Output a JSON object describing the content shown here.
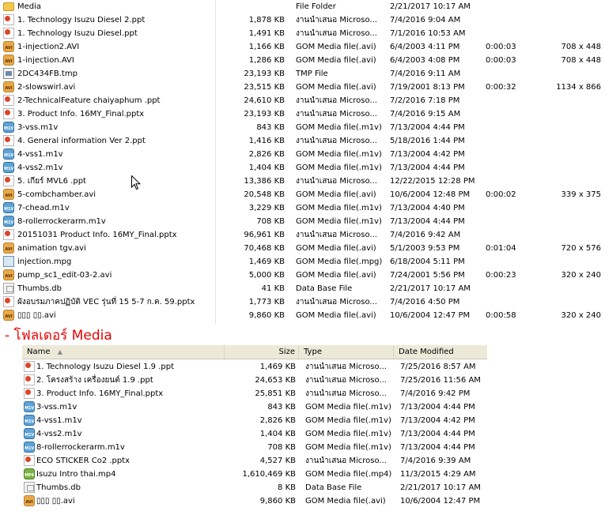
{
  "panel1": {
    "rows": [
      {
        "icon": "folder-icon",
        "name": "Media",
        "size": "",
        "type": "File Folder",
        "date": "2/21/2017 10:17 AM",
        "duration": "",
        "dimensions": ""
      },
      {
        "icon": "ppt-icon",
        "name": "1. Technology Isuzu Diesel 2.ppt",
        "size": "1,878 KB",
        "type": "งานนำเสนอ Microso...",
        "date": "7/4/2016 9:04 AM",
        "duration": "",
        "dimensions": ""
      },
      {
        "icon": "ppt-icon",
        "name": "1. Technology Isuzu Diesel.ppt",
        "size": "1,491 KB",
        "type": "งานนำเสนอ Microso...",
        "date": "7/1/2016 10:53 AM",
        "duration": "",
        "dimensions": ""
      },
      {
        "icon": "avi-icon",
        "name": "1-injection2.AVI",
        "size": "1,166 KB",
        "type": "GOM Media file(.avi)",
        "date": "6/4/2003 4:11 PM",
        "duration": "0:00:03",
        "dimensions": "708 x 448"
      },
      {
        "icon": "avi-icon",
        "name": "1-injection.AVI",
        "size": "1,286 KB",
        "type": "GOM Media file(.avi)",
        "date": "6/4/2003 4:08 PM",
        "duration": "0:00:03",
        "dimensions": "708 x 448"
      },
      {
        "icon": "tmp-icon",
        "name": "2DC434FB.tmp",
        "size": "23,193 KB",
        "type": "TMP File",
        "date": "7/4/2016 9:11 AM",
        "duration": "",
        "dimensions": ""
      },
      {
        "icon": "avi-icon",
        "name": "2-slowswirl.avi",
        "size": "23,515 KB",
        "type": "GOM Media file(.avi)",
        "date": "7/19/2001 8:13 PM",
        "duration": "0:00:32",
        "dimensions": "1134 x 866"
      },
      {
        "icon": "ppt-icon",
        "name": "2-TechnicalFeature chaiyaphum .ppt",
        "size": "24,610 KB",
        "type": "งานนำเสนอ Microso...",
        "date": "7/2/2016 7:18 PM",
        "duration": "",
        "dimensions": ""
      },
      {
        "icon": "ppt-icon",
        "name": "3. Product Info. 16MY_Final.pptx",
        "size": "23,193 KB",
        "type": "งานนำเสนอ Microso...",
        "date": "7/4/2016 9:15 AM",
        "duration": "",
        "dimensions": ""
      },
      {
        "icon": "m1v-icon",
        "name": "3-vss.m1v",
        "size": "843 KB",
        "type": "GOM Media file(.m1v)",
        "date": "7/13/2004 4:44 PM",
        "duration": "",
        "dimensions": ""
      },
      {
        "icon": "ppt-icon",
        "name": "4. General information Ver 2.ppt",
        "size": "1,416 KB",
        "type": "งานนำเสนอ Microso...",
        "date": "5/18/2016 1:44 PM",
        "duration": "",
        "dimensions": ""
      },
      {
        "icon": "m1v-icon",
        "name": "4-vss1.m1v",
        "size": "2,826 KB",
        "type": "GOM Media file(.m1v)",
        "date": "7/13/2004 4:42 PM",
        "duration": "",
        "dimensions": ""
      },
      {
        "icon": "m1v-icon",
        "name": "4-vss2.m1v",
        "size": "1,404 KB",
        "type": "GOM Media file(.m1v)",
        "date": "7/13/2004 4:44 PM",
        "duration": "",
        "dimensions": ""
      },
      {
        "icon": "ppt-icon",
        "name": "5. เกียร์  MVL6  .ppt",
        "size": "13,386 KB",
        "type": "งานนำเสนอ Microso...",
        "date": "12/22/2015 12:28 PM",
        "duration": "",
        "dimensions": ""
      },
      {
        "icon": "avi-icon",
        "name": "5-combchamber.avi",
        "size": "20,548 KB",
        "type": "GOM Media file(.avi)",
        "date": "10/6/2004 12:48 PM",
        "duration": "0:00:02",
        "dimensions": "339 x 375"
      },
      {
        "icon": "m1v-icon",
        "name": "7-chead.m1v",
        "size": "3,229 KB",
        "type": "GOM Media file(.m1v)",
        "date": "7/13/2004 4:40 PM",
        "duration": "",
        "dimensions": ""
      },
      {
        "icon": "m1v-icon",
        "name": "8-rollerrockerarm.m1v",
        "size": "708 KB",
        "type": "GOM Media file(.m1v)",
        "date": "7/13/2004 4:44 PM",
        "duration": "",
        "dimensions": ""
      },
      {
        "icon": "ppt-icon",
        "name": "20151031 Product Info. 16MY_Final.pptx",
        "size": "96,961 KB",
        "type": "งานนำเสนอ Microso...",
        "date": "7/4/2016 9:42 AM",
        "duration": "",
        "dimensions": ""
      },
      {
        "icon": "avi-icon",
        "name": "animation tgv.avi",
        "size": "70,468 KB",
        "type": "GOM Media file(.avi)",
        "date": "5/1/2003 9:53 PM",
        "duration": "0:01:04",
        "dimensions": "720 x 576"
      },
      {
        "icon": "mpg-icon",
        "name": "injection.mpg",
        "size": "1,469 KB",
        "type": "GOM Media file(.mpg)",
        "date": "6/18/2004 5:11 PM",
        "duration": "",
        "dimensions": ""
      },
      {
        "icon": "avi-icon",
        "name": "pump_sc1_edit-03-2.avi",
        "size": "5,000 KB",
        "type": "GOM Media file(.avi)",
        "date": "7/24/2001 5:56 PM",
        "duration": "0:00:23",
        "dimensions": "320 x 240"
      },
      {
        "icon": "db-icon",
        "name": "Thumbs.db",
        "size": "41 KB",
        "type": "Data Base File",
        "date": "2/21/2017 10:17 AM",
        "duration": "",
        "dimensions": ""
      },
      {
        "icon": "ppt-icon",
        "name": "ผังอบรมภาคปฏิบัติ VEC รุ่นที่ 15 5-7 ก.ค. 59.pptx",
        "size": "1,773 KB",
        "type": "งานนำเสนอ Microso...",
        "date": "7/4/2016 4:50 PM",
        "duration": "",
        "dimensions": ""
      },
      {
        "icon": "avi-icon",
        "name": "▯▯▯ ▯▯.avi",
        "size": "9,860 KB",
        "type": "GOM Media file(.avi)",
        "date": "10/6/2004 12:47 PM",
        "duration": "0:00:58",
        "dimensions": "320 x 240"
      }
    ]
  },
  "caption": "- โฟลเดอร์ Media",
  "panel2": {
    "headers": {
      "name": "Name",
      "size": "Size",
      "type": "Type",
      "date": "Date Modified",
      "sort_indicator": "▲"
    },
    "rows": [
      {
        "icon": "ppt-icon",
        "name": "1. Technology Isuzu Diesel  1.9 .ppt",
        "size": "1,469 KB",
        "type": "งานนำเสนอ Microso...",
        "date": "7/25/2016 8:57 AM"
      },
      {
        "icon": "ppt-icon",
        "name": "2. โครงสร้าง เครื่องยนต์ 1.9  .ppt",
        "size": "24,653 KB",
        "type": "งานนำเสนอ Microso...",
        "date": "7/25/2016 11:56 AM"
      },
      {
        "icon": "ppt-icon",
        "name": "3. Product Info. 16MY_Final.pptx",
        "size": "25,851 KB",
        "type": "งานนำเสนอ Microso...",
        "date": "7/4/2016 9:42 PM"
      },
      {
        "icon": "m1v-icon",
        "name": "3-vss.m1v",
        "size": "843 KB",
        "type": "GOM Media file(.m1v)",
        "date": "7/13/2004 4:44 PM"
      },
      {
        "icon": "m1v-icon",
        "name": "4-vss1.m1v",
        "size": "2,826 KB",
        "type": "GOM Media file(.m1v)",
        "date": "7/13/2004 4:42 PM"
      },
      {
        "icon": "m1v-icon",
        "name": "4-vss2.m1v",
        "size": "1,404 KB",
        "type": "GOM Media file(.m1v)",
        "date": "7/13/2004 4:44 PM"
      },
      {
        "icon": "m1v-icon",
        "name": "8-rollerrockerarm.m1v",
        "size": "708 KB",
        "type": "GOM Media file(.m1v)",
        "date": "7/13/2004 4:44 PM"
      },
      {
        "icon": "ppt-icon",
        "name": "ECO STICKER Co2 .pptx",
        "size": "4,527 KB",
        "type": "งานนำเสนอ Microso...",
        "date": "7/4/2016 9:39 AM"
      },
      {
        "icon": "mp4-icon",
        "name": "Isuzu Intro thai.mp4",
        "size": "1,610,469 KB",
        "type": "GOM Media file(.mp4)",
        "date": "11/3/2015 4:29 AM"
      },
      {
        "icon": "db-icon",
        "name": "Thumbs.db",
        "size": "8 KB",
        "type": "Data Base File",
        "date": "2/21/2017 10:17 AM"
      },
      {
        "icon": "avi-icon",
        "name": "▯▯▯ ▯▯.avi",
        "size": "9,860 KB",
        "type": "GOM Media file(.avi)",
        "date": "10/6/2004 12:47 PM"
      }
    ]
  },
  "colors": {
    "caption": "#e60000",
    "header_bg": "#ece9d8"
  }
}
